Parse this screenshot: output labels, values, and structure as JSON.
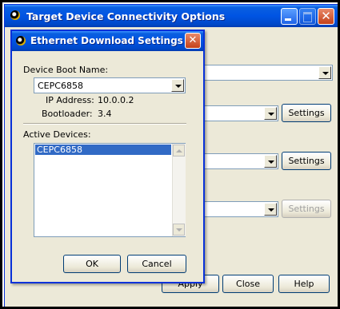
{
  "main_window": {
    "title": "Target Device Connectivity Options",
    "buttons": {
      "settings_1": "Settings",
      "settings_2": "Settings",
      "settings_3": "Settings",
      "apply": "Apply",
      "close": "Close",
      "help": "Help"
    }
  },
  "dialog": {
    "title": "Ethernet Download Settings",
    "device_boot_name_label": "Device Boot Name:",
    "device_boot_name_value": "CEPC6858",
    "ip_address_label": "IP Address:",
    "ip_address_value": "10.0.0.2",
    "bootloader_label": "Bootloader:",
    "bootloader_value": "3.4",
    "active_devices_label": "Active Devices:",
    "active_devices": [
      "CEPC6858"
    ],
    "ok_label": "OK",
    "cancel_label": "Cancel",
    "close_glyph": "✕"
  },
  "icons": [
    "app-icon",
    "close-icon",
    "minimize-icon",
    "maximize-icon",
    "dropdown-arrow-icon",
    "scroll-up-icon",
    "scroll-down-icon"
  ],
  "colors": {
    "titlebar": "#0054e3",
    "selection": "#316ac5",
    "dialog_bg": "#ece9d8"
  }
}
